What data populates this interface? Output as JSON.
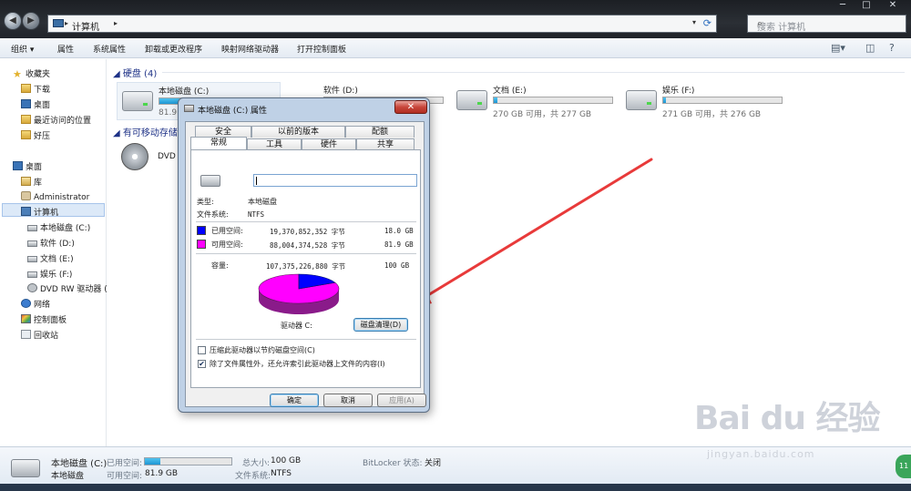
{
  "address_bar": {
    "crumb": "计算机",
    "search_placeholder": "搜索 计算机"
  },
  "toolbar": {
    "items": [
      "组织 ▾",
      "属性",
      "系统属性",
      "卸载或更改程序",
      "映射网络驱动器",
      "打开控制面板"
    ]
  },
  "sidebar": {
    "favorites": "收藏夹",
    "downloads": "下载",
    "desktop_fav": "桌面",
    "recent": "最近访问的位置",
    "haoya": "好压",
    "desktop": "桌面",
    "library": "库",
    "admin": "Administrator",
    "computer": "计算机",
    "drive_c": "本地磁盘 (C:)",
    "drive_d": "软件 (D:)",
    "drive_e": "文档 (E:)",
    "drive_f": "娱乐 (F:)",
    "dvd": "DVD RW 驱动器 (",
    "network": "网络",
    "control_panel": "控制面板",
    "recycle": "回收站"
  },
  "main": {
    "hdd_group": "硬盘 (4)",
    "removable_group": "有可移动存储",
    "drives": [
      {
        "name": "本地磁盘 (C:)",
        "free_text": "81.9 G",
        "used_fraction": 0.18
      },
      {
        "name": "软件 (D:)",
        "free_text": "",
        "used_fraction": 0.03
      },
      {
        "name": "文档 (E:)",
        "free_text": "270 GB 可用，共 277 GB",
        "used_fraction": 0.03
      },
      {
        "name": "娱乐 (F:)",
        "free_text": "271 GB 可用，共 276 GB",
        "used_fraction": 0.02
      }
    ],
    "dvd_name": "DVD R"
  },
  "details": {
    "name": "本地磁盘 (C:)",
    "type": "本地磁盘",
    "used_label": "已用空间:",
    "free_label": "可用空间:",
    "free_value": "81.9 GB",
    "total_label": "总大小:",
    "total_value": "100 GB",
    "fs_label": "文件系统:",
    "fs_value": "NTFS",
    "bitlocker_label": "BitLocker 状态:",
    "bitlocker_value": "关闭",
    "used_fraction": 0.18
  },
  "dialog": {
    "title": "本地磁盘 (C:) 属性",
    "close": "✕",
    "tabs_row1": [
      "安全",
      "以前的版本",
      "配额"
    ],
    "tabs_row2": [
      "常规",
      "工具",
      "硬件",
      "共享"
    ],
    "name_value": "",
    "type_label": "类型:",
    "type_value": "本地磁盘",
    "fs_label": "文件系统:",
    "fs_value": "NTFS",
    "used_label": "已用空间:",
    "used_bytes": "19,370,852,352 字节",
    "used_size": "18.0 GB",
    "free_label": "可用空间:",
    "free_bytes": "88,004,374,528 字节",
    "free_size": "81.9 GB",
    "cap_label": "容量:",
    "cap_bytes": "107,375,226,880 字节",
    "cap_size": "100 GB",
    "drive_label": "驱动器 C:",
    "cleanup_button": "磁盘清理(D)",
    "compress_label": "压缩此驱动器以节约磁盘空间(C)",
    "compress_checked": false,
    "index_label": "除了文件属性外，还允许索引此驱动器上文件的内容(I)",
    "index_checked": true,
    "ok": "确定",
    "cancel": "取消",
    "apply": "应用(A)",
    "used_fraction": 0.18,
    "colors": {
      "used": "#0000ff",
      "free": "#ff00ff"
    }
  },
  "watermark": {
    "main": "Bai du 经验",
    "sub": "jingyan.baidu.com"
  },
  "annotation": {
    "color": "#e83a3a"
  }
}
